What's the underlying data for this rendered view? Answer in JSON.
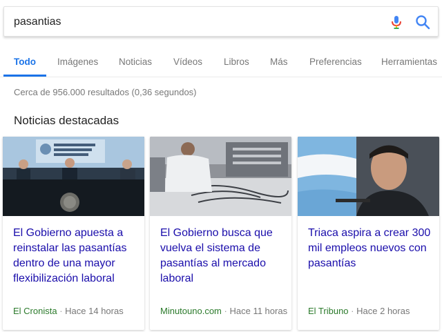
{
  "search": {
    "query": "pasantias"
  },
  "colors": {
    "accent": "#1a73e8",
    "link": "#1a0dab",
    "source": "#2b7a2b",
    "muted": "#777777"
  },
  "tabs": [
    {
      "label": "Todo",
      "active": true
    },
    {
      "label": "Imágenes"
    },
    {
      "label": "Noticias"
    },
    {
      "label": "Vídeos"
    },
    {
      "label": "Libros"
    },
    {
      "label": "Más"
    },
    {
      "label": "Preferencias"
    },
    {
      "label": "Herramientas"
    }
  ],
  "results": {
    "stats": "Cerca de 956.000 resultados (0,36 segundos)"
  },
  "news": {
    "heading": "Noticias destacadas",
    "separator": "·",
    "cards": [
      {
        "title": "El Gobierno apuesta a reinstalar las pasantías dentro de una mayor flexibilización laboral",
        "source": "El Cronista",
        "time": "Hace 14 horas"
      },
      {
        "title": "El Gobierno busca que vuelva el sistema de pasantías al mercado laboral",
        "source": "Minutouno.com",
        "time": "Hace 11 horas"
      },
      {
        "title": "Triaca aspira a crear 300 mil empleos nuevos con pasantías",
        "source": "El Tribuno",
        "time": "Hace 2 horas"
      }
    ]
  }
}
